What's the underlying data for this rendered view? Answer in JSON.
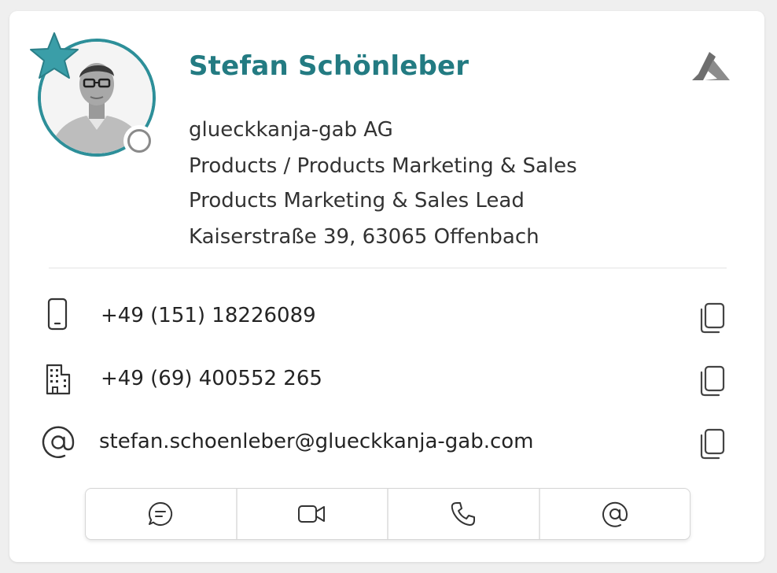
{
  "contact": {
    "name": "Stefan Schönleber",
    "company": "glueckkanja-gab AG",
    "department": "Products / Products Marketing & Sales",
    "job_title": "Products Marketing & Sales Lead",
    "address": "Kaiserstraße 39, 63065 Offenbach",
    "is_favorite": true,
    "presence": "offline"
  },
  "contact_rows": [
    {
      "icon": "mobile-phone-icon",
      "value": "+49 (151) 18226089",
      "copy_icon": "copy-icon"
    },
    {
      "icon": "building-icon",
      "value": "+49 (69) 400552 265",
      "copy_icon": "copy-icon"
    },
    {
      "icon": "at-sign-icon",
      "value": "stefan.schoenleber@glueckkanja-gab.com",
      "copy_icon": "copy-icon"
    }
  ],
  "actions": [
    {
      "icon": "chat-icon"
    },
    {
      "icon": "video-call-icon"
    },
    {
      "icon": "phone-call-icon"
    },
    {
      "icon": "email-icon"
    }
  ],
  "colors": {
    "accent": "#2d8f99",
    "name_text": "#237b82",
    "presence_offline": "#8a8a8a"
  },
  "brand_icon": "azure-logo-icon"
}
